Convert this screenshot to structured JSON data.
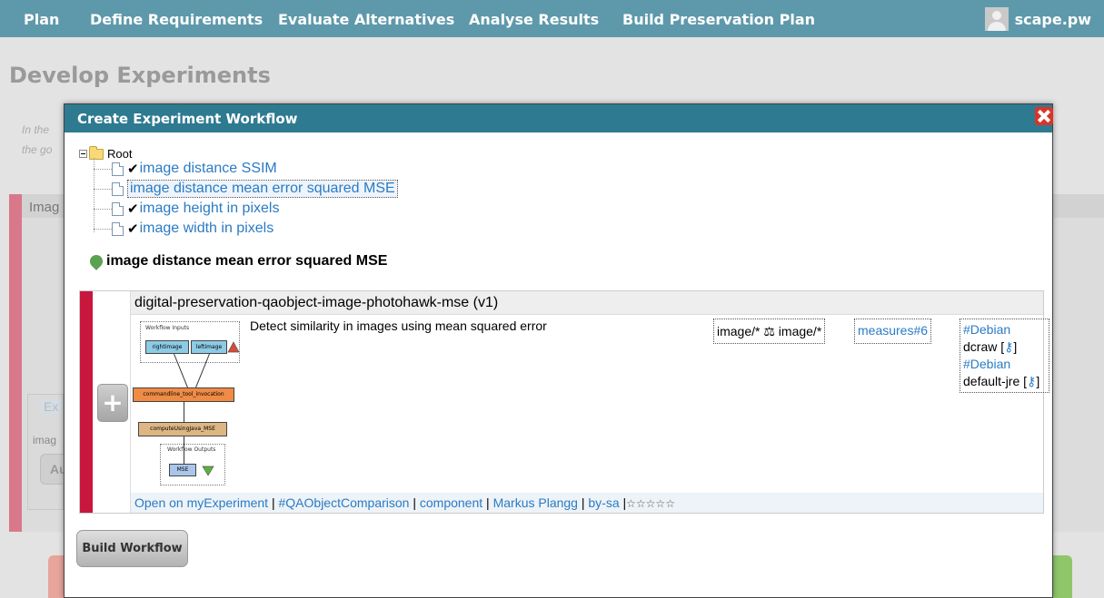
{
  "nav": {
    "items": [
      "Plan",
      "Define Requirements",
      "Evaluate Alternatives",
      "Analyse Results",
      "Build Preservation Plan"
    ],
    "user": "scape.pw"
  },
  "page": {
    "title": "Develop Experiments",
    "intro_line1": "In the",
    "intro_line2": "the go",
    "panel_title": "Imag",
    "exp_tag": "Ex",
    "exp_label": "imag",
    "exp_button": "Au"
  },
  "modal": {
    "title": "Create Experiment Workflow",
    "tree": {
      "root": "Root",
      "items": [
        {
          "label": "image distance SSIM",
          "checked": true
        },
        {
          "label": "image distance mean error squared MSE",
          "checked": false,
          "selected": true
        },
        {
          "label": "image height in pixels",
          "checked": true
        },
        {
          "label": "image width in pixels",
          "checked": true
        }
      ]
    },
    "selected_measure": "image distance mean error squared MSE",
    "component": {
      "name": "digital-preservation-qaobject-image-photohawk-mse (v1)",
      "description": "Detect similarity in images using mean squared error",
      "mimetypes": "image/* ⚖ image/*",
      "measures": "measures#6",
      "dependencies": [
        {
          "repo": "#Debian",
          "package": "dcraw"
        },
        {
          "repo": "#Debian",
          "package": "default-jre"
        }
      ],
      "workflow": {
        "inputs_label": "Workflow Inputs",
        "input1": "rightimage",
        "input2": "leftimage",
        "step1": "commandline_tool_invocation",
        "step2": "computeUsingJava_MSE",
        "outputs_label": "Workflow Outputs",
        "output": "MSE"
      },
      "footer": {
        "open": "Open on myExperiment",
        "tag": "#QAObjectComparison",
        "type": "component",
        "author": "Markus Plangg",
        "license": "by-sa",
        "rating": "☆☆☆☆☆"
      }
    },
    "build_button": "Build Workflow"
  },
  "colors": {
    "nav_bg": "#5e99ab",
    "modal_header": "#2d7a91",
    "card_stripe": "#c8163d",
    "link": "#2a7bc4"
  }
}
